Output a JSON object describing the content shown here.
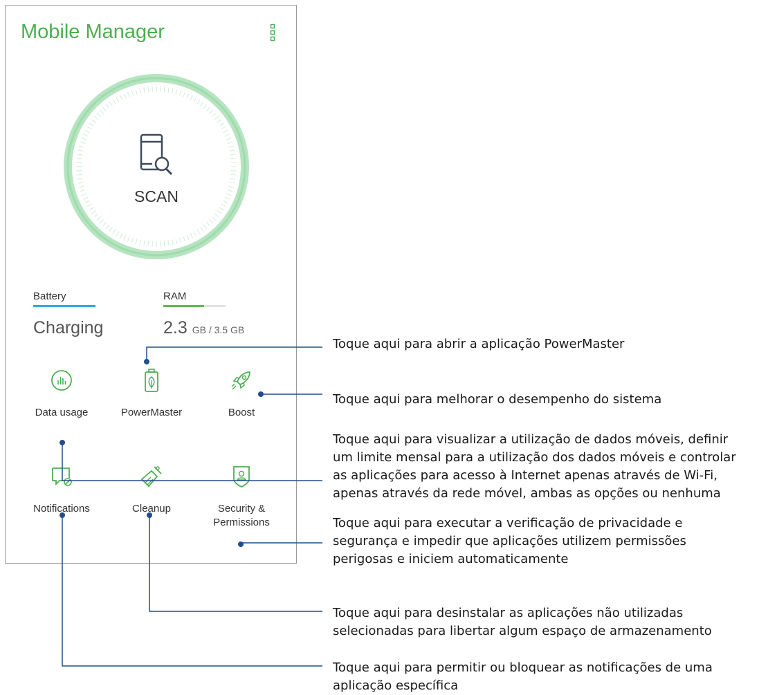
{
  "app": {
    "title": "Mobile Manager",
    "menu_icon": "more-vertical-icon",
    "accent_color": "#4caf50"
  },
  "scan": {
    "label": "SCAN",
    "icon": "phone-search-icon"
  },
  "stats": {
    "battery": {
      "label": "Battery",
      "value": "Charging",
      "bar_color": "#35a9e0",
      "level": 1.0
    },
    "ram": {
      "label": "RAM",
      "value": "2.3",
      "unit": "GB / 3.5 GB",
      "bar_color": "#5cbf4a",
      "level": 0.66
    }
  },
  "tiles": [
    {
      "label": "Data usage",
      "icon": "data-usage-icon"
    },
    {
      "label": "PowerMaster",
      "icon": "battery-leaf-icon"
    },
    {
      "label": "Boost",
      "icon": "rocket-icon"
    },
    {
      "label": "Notifications",
      "icon": "notification-block-icon"
    },
    {
      "label": "Cleanup",
      "icon": "broom-icon"
    },
    {
      "label": "Security &",
      "label2": "Permissions",
      "icon": "shield-user-icon"
    }
  ],
  "callouts": [
    {
      "lines": [
        "Toque aqui para abrir a aplicação PowerMaster"
      ]
    },
    {
      "lines": [
        "Toque aqui para melhorar o desempenho do sistema"
      ]
    },
    {
      "lines": [
        "Toque aqui para visualizar a utilização de dados móveis, definir",
        "um limite mensal para a utilização dos dados móveis e controlar",
        "as aplicações para acesso à Internet apenas através de Wi-Fi,",
        "apenas através da rede móvel, ambas as opções ou nenhuma"
      ]
    },
    {
      "lines": [
        "Toque aqui para executar a verificação de privacidade e",
        "segurança e impedir que aplicações utilizem permissões",
        "perigosas e iniciem automaticamente"
      ]
    },
    {
      "lines": [
        "Toque aqui para desinstalar as aplicações não utilizadas",
        "selecionadas para libertar algum espaço de armazenamento"
      ]
    },
    {
      "lines": [
        "Toque aqui para permitir ou bloquear as notificações de uma",
        "aplicação específica"
      ]
    }
  ],
  "leader_color": "#1f4e8c"
}
